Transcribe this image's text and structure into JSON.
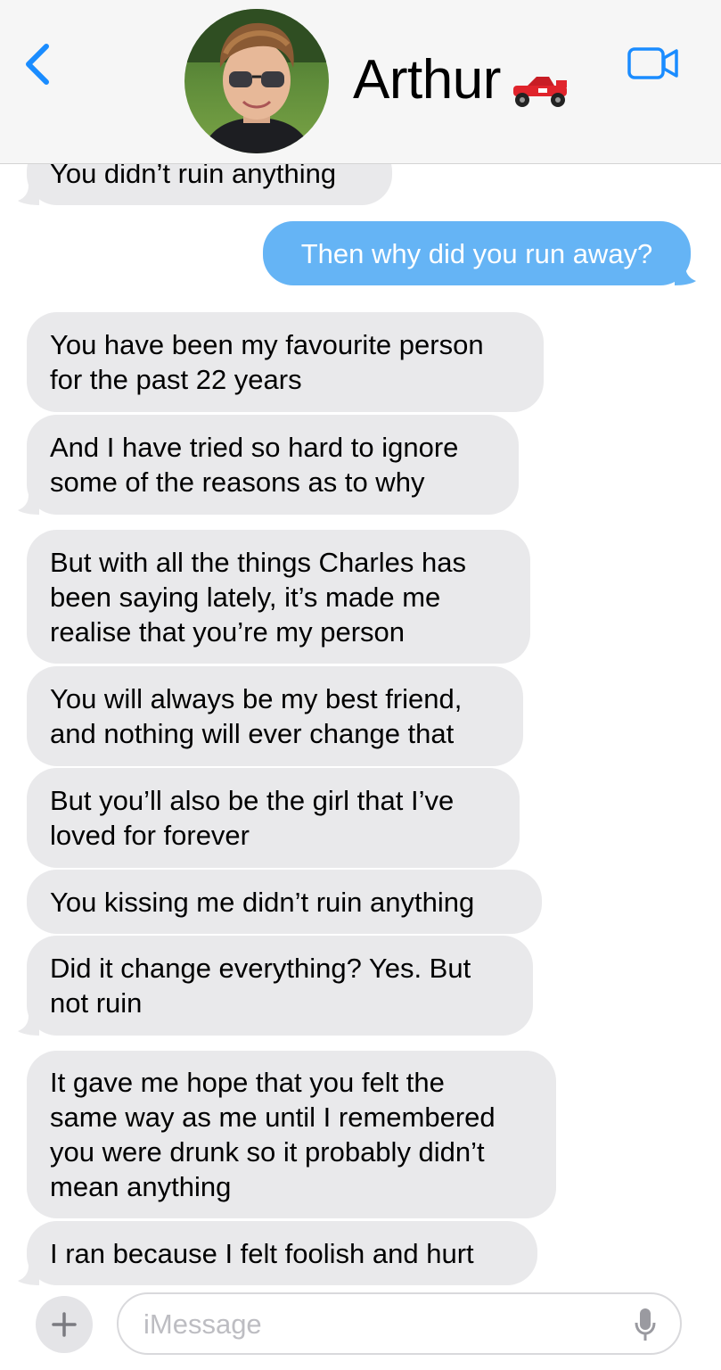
{
  "header": {
    "contact_name": "Arthur",
    "back_icon": "chevron-left-icon",
    "status_icon": "racing-car-icon",
    "video_icon": "video-camera-icon",
    "accent_color": "#1a8cff"
  },
  "messages": [
    {
      "direction": "incoming",
      "text": "You didn’t ruin anything"
    },
    {
      "direction": "outgoing",
      "text": "Then why did you run away?"
    },
    {
      "direction": "incoming",
      "text": "You have been my favourite person\nfor the past 22 years"
    },
    {
      "direction": "incoming",
      "text": "And I have tried so hard to ignore\nsome of the reasons as to why"
    },
    {
      "direction": "incoming",
      "text": "But with all the things Charles has\nbeen saying lately, it’s made me\nrealise that you’re my person"
    },
    {
      "direction": "incoming",
      "text": "You will always be my best friend,\nand nothing will ever change that"
    },
    {
      "direction": "incoming",
      "text": "But you’ll also be the girl that I’ve\nloved for forever"
    },
    {
      "direction": "incoming",
      "text": "You kissing me didn’t ruin anything"
    },
    {
      "direction": "incoming",
      "text": "Did it change everything? Yes. But\nnot ruin"
    },
    {
      "direction": "incoming",
      "text": "It gave me hope that you felt the\nsame way as me until I remembered\nyou were drunk so it probably didn’t\nmean anything"
    },
    {
      "direction": "incoming",
      "text": "I ran because I felt foolish and hurt"
    }
  ],
  "composer": {
    "placeholder": "iMessage",
    "plus_icon": "plus-icon",
    "mic_icon": "microphone-icon"
  },
  "colors": {
    "incoming_bubble": "#e9e9eb",
    "outgoing_bubble": "#65b4f5",
    "header_bg": "#f6f6f6"
  }
}
